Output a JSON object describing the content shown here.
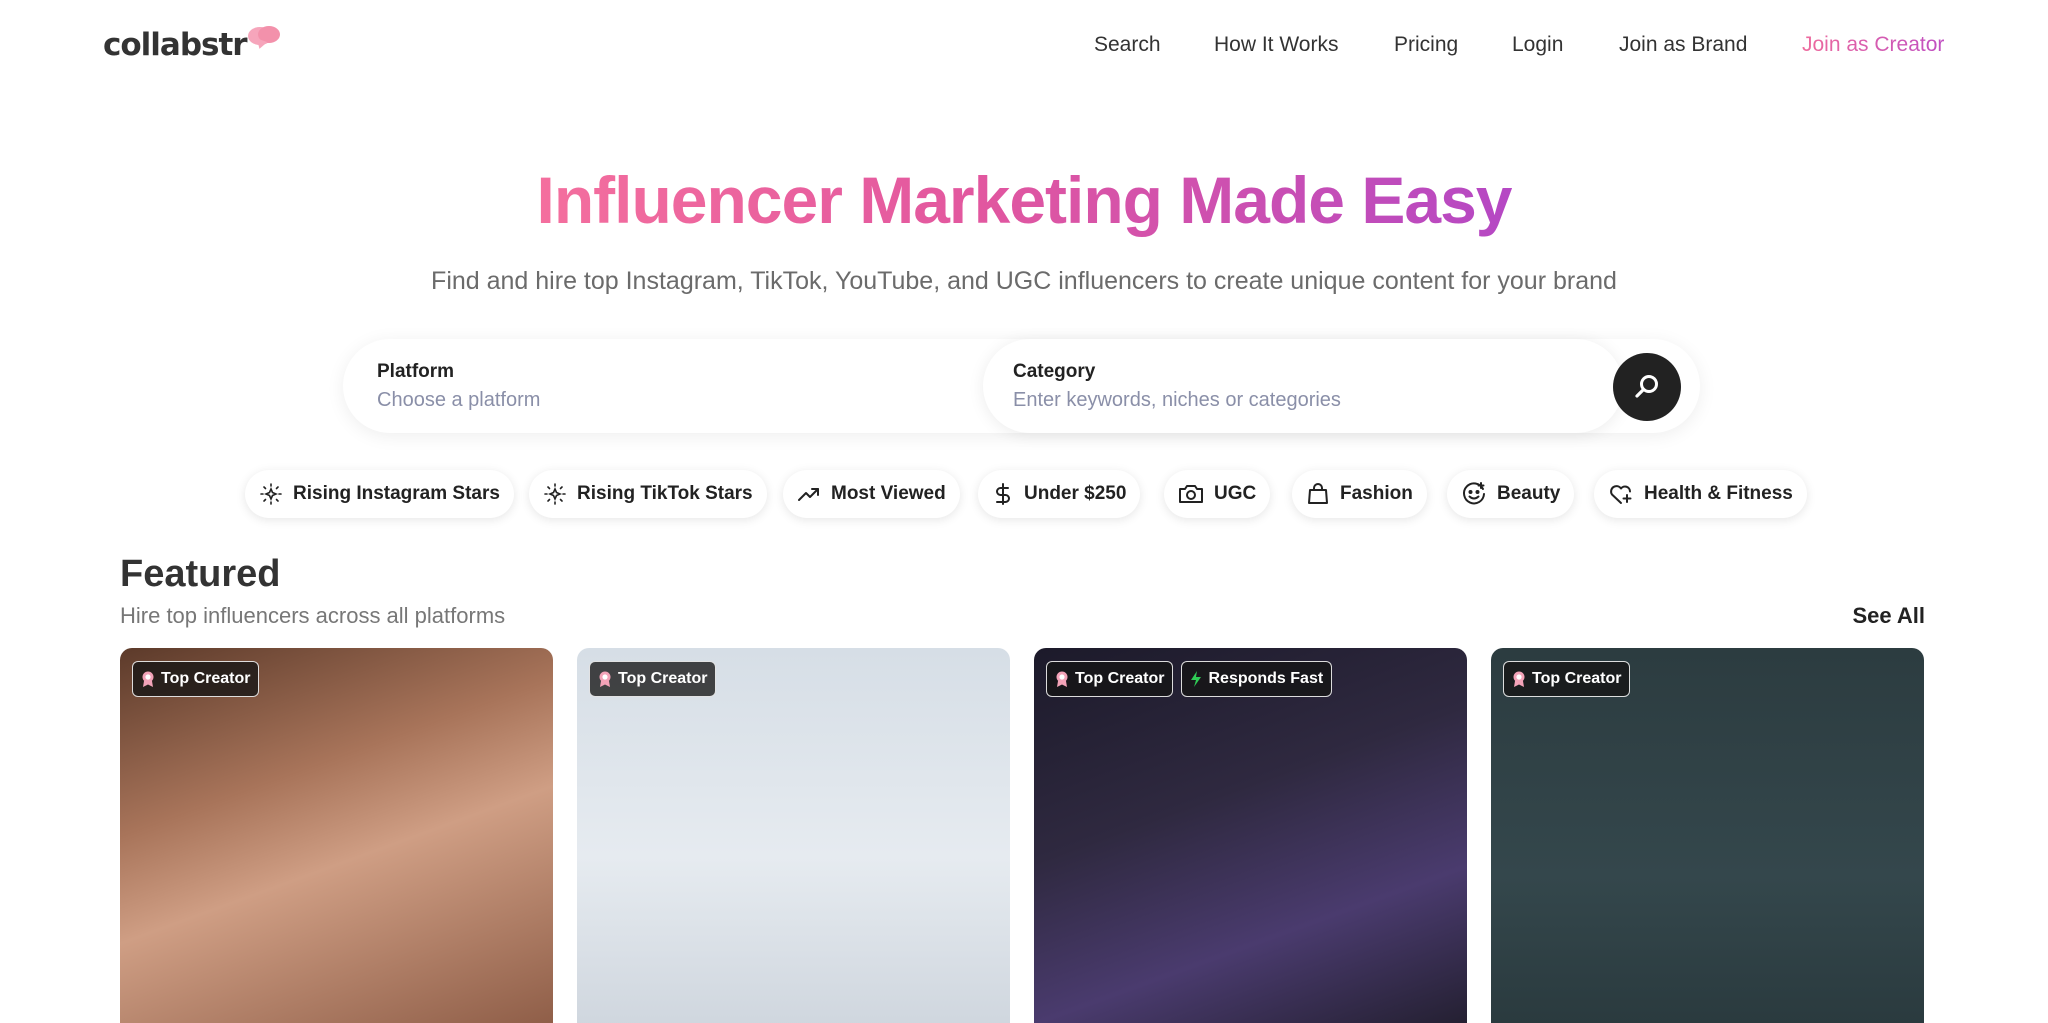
{
  "brand": {
    "name": "collabstr"
  },
  "nav": {
    "search": "Search",
    "how_it_works": "How It Works",
    "pricing": "Pricing",
    "login": "Login",
    "join_brand": "Join as Brand",
    "join_creator": "Join as Creator"
  },
  "hero": {
    "title": "Influencer Marketing Made Easy",
    "subtitle": "Find and hire top Instagram, TikTok, YouTube, and UGC influencers to create unique content for your brand"
  },
  "search": {
    "platform_label": "Platform",
    "platform_placeholder": "Choose a platform",
    "category_label": "Category",
    "category_placeholder": "Enter keywords, niches or categories"
  },
  "chips": [
    {
      "label": "Rising Instagram Stars",
      "icon": "sparkle-icon"
    },
    {
      "label": "Rising TikTok Stars",
      "icon": "sparkle-icon"
    },
    {
      "label": "Most Viewed",
      "icon": "trending-up-icon"
    },
    {
      "label": "Under $250",
      "icon": "dollar-icon"
    },
    {
      "label": "UGC",
      "icon": "camera-icon"
    },
    {
      "label": "Fashion",
      "icon": "shopping-bag-icon"
    },
    {
      "label": "Beauty",
      "icon": "smile-icon"
    },
    {
      "label": "Health & Fitness",
      "icon": "heart-plus-icon"
    }
  ],
  "featured": {
    "title": "Featured",
    "subtitle": "Hire top influencers across all platforms",
    "see_all": "See All",
    "cards": [
      {
        "badges": [
          "Top Creator"
        ]
      },
      {
        "badges": [
          "Top Creator"
        ]
      },
      {
        "badges": [
          "Top Creator",
          "Responds Fast"
        ]
      },
      {
        "badges": [
          "Top Creator"
        ]
      }
    ]
  },
  "colors": {
    "accent_gradient_start": "#f46f9e",
    "accent_gradient_end": "#b548c4",
    "search_button": "#222222",
    "responds_fast_icon": "#2ecc55"
  }
}
